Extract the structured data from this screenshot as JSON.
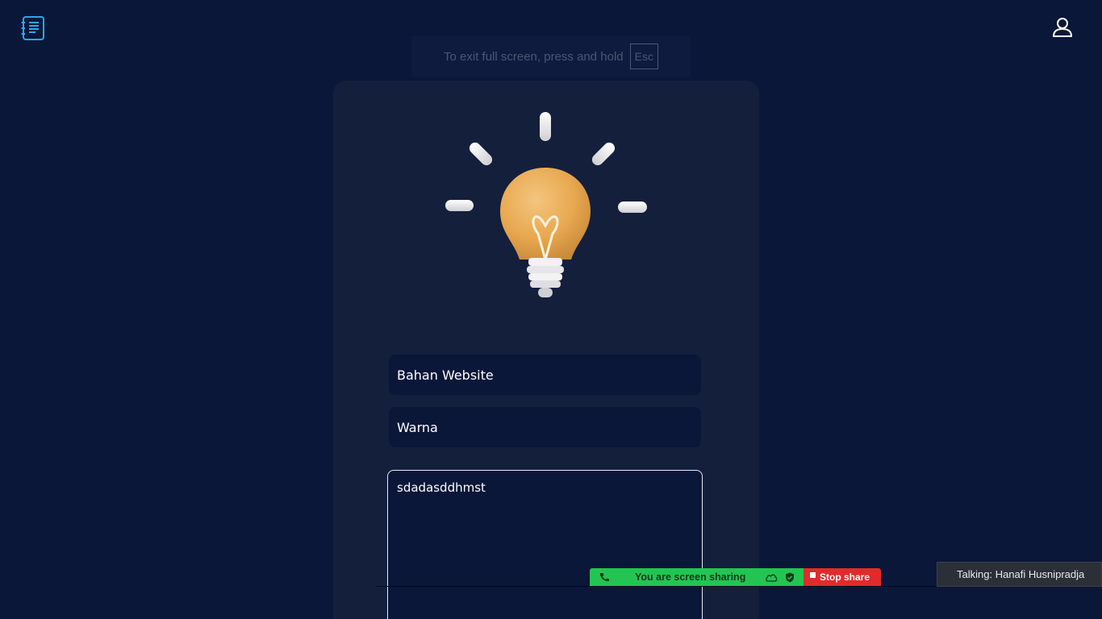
{
  "header": {
    "logo_icon": "notebook-list-icon",
    "profile_icon": "user-icon",
    "accent": "#2aa7f0"
  },
  "fullscreen_notice": {
    "text": "To exit full screen, press and hold",
    "key": "Esc"
  },
  "form": {
    "illustration": "lightbulb-icon",
    "field1_value": "Bahan Website",
    "field2_value": "Warna",
    "textarea_value": "sdadasddhmst"
  },
  "screen_share": {
    "message": "You are screen sharing",
    "stop_label": "Stop share",
    "green": "#23c552",
    "red": "#e02b2b"
  },
  "talking": {
    "text": "Talking: Hanafi Husnipradja"
  },
  "colors": {
    "background": "#0b1739",
    "card": "#141f3c",
    "bulb": "#e8a850"
  }
}
